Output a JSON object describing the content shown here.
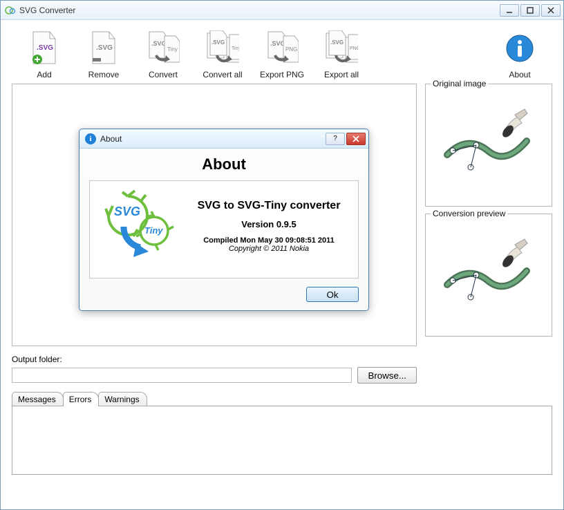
{
  "window": {
    "title": "SVG Converter"
  },
  "toolbar": {
    "add": "Add",
    "remove": "Remove",
    "convert": "Convert",
    "convert_all": "Convert all",
    "export_png": "Export PNG",
    "export_all": "Export all",
    "about": "About"
  },
  "panels": {
    "original": "Original image",
    "preview": "Conversion preview"
  },
  "output": {
    "label": "Output folder:",
    "value": "",
    "browse": "Browse..."
  },
  "tabs": {
    "messages": "Messages",
    "errors": "Errors",
    "warnings": "Warnings",
    "active": "errors"
  },
  "about_dialog": {
    "title": "About",
    "heading": "About",
    "name": "SVG to SVG-Tiny converter",
    "version": "Version 0.9.5",
    "compiled": "Compiled Mon May 30 09:08:51 2011",
    "copyright": "Copyright © 2011 Nokia",
    "ok": "Ok"
  }
}
